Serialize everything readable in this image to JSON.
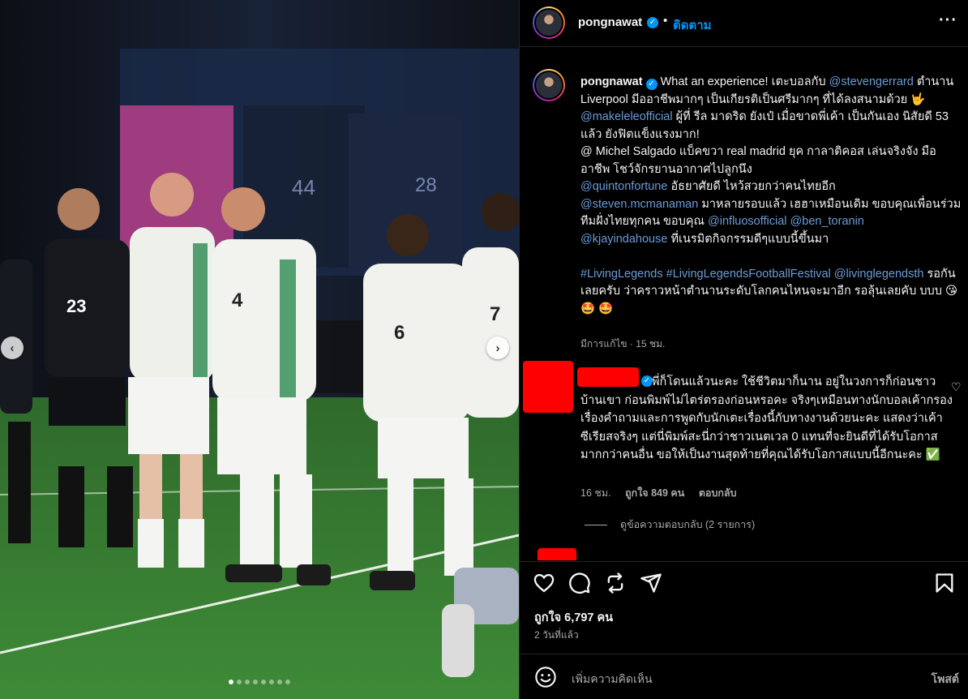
{
  "post": {
    "photo": {
      "jersey_numbers": [
        "23",
        "4",
        "6",
        "7",
        "44",
        "28"
      ],
      "carousel_prev": "‹",
      "carousel_next": "›",
      "dot_count": 8,
      "active_dot": 0
    },
    "header": {
      "username": "pongnawat",
      "bullet": "•",
      "follow_label": "ติดตาม",
      "more_label": "···"
    },
    "caption": {
      "username": "pongnawat",
      "text_a": "What an experience! เตะบอลกับ",
      "mention_gerrard": "@stevengerrard",
      "text_b": "ตำนาน Liverpool มีออาชีพมากๆ เป็นเกียรติเป็นศรีมากๆ ที่ได้ลงสนามด้วย 🤟",
      "mention_makelele": "@makeleleofficial",
      "text_c": "ผู้ที่ รีล มาดริด ยังเป๋ เมื่อขาดพี่เค้า เป็นกันเอง นิสัยดี 53 แล้ว ยังฟิตแข็งแรงมาก!",
      "text_d": "@ Michel Salgado แบ็คขวา real madrid ยุค กาลาติคอส เล่นจริงจัง มืออาชีพ โชว์จักรยานอากาศไปลูกนึง",
      "mention_fortune": "@quintonfortune",
      "text_e": "อัธยาศัยดี ไหว้สวยกว่าคนไทยอีก",
      "mention_mcmanaman": "@steven.mcmanaman",
      "text_f": "มาหลายรอบแล้ว เฮฮาเหมือนเดิม ขอบคุณเพื่อนร่วมทีมฝั่งไทยทุกคน ขอบคุณ",
      "mention_influos": "@influosofficial",
      "mention_toranin": "@ben_toranin",
      "mention_kjayinda": "@kjayindahouse",
      "text_g": "ที่เนรมิตกิจกรรมดีๆแบบนี้ขึ้นมา",
      "hashtag_1": "#LivingLegends",
      "hashtag_2": "#LivingLegendsFootballFestival",
      "mention_livinglegends": "@livinglegendsth",
      "text_h": "รอกันเลยครับ ว่าคราวหน้าตำนานระดับโลกคนไหนจะมาอีก รอลุ้นเลยคับ บบบ 😘 🤩 🤩",
      "meta": "มีการแก้ไข · 15 ชม."
    },
    "comment": {
      "text": "พี่ก็โดนแล้วนะคะ ใช้ชีวิตมาก็นาน อยู่ในวงการก็ก่อนชาวบ้านเขา ก่อนพิมพ์ไม่ไตร่ตรองก่อนหรอคะ จริงๆเหมือนทางนักบอลเค้ากรองเรื่องคำถามและการพูดกับนักเตะเรื่องนี้กับทางงานด้วยนะคะ แสดงว่าเค้าซีเรียสจริงๆ แต่นี่พิมพ์สะนี่กว่าชาวเนตเวล 0 แทนที่จะยินดีที่ได้รับโอกาสมากกว่าคนอื่น ขอให้เป็นงานสุดท้ายที่คุณได้รับโอกาสแบบนี้อีกนะคะ ✅",
      "time": "16 ชม.",
      "likes": "ถูกใจ 849 คน",
      "reply": "ตอบกลับ",
      "view_replies": "ดูข้อความตอบกลับ (2 รายการ)"
    },
    "actions": {
      "likes_count": "ถูกใจ 6,797 คน",
      "time_ago": "2 วันที่แล้ว"
    },
    "compose": {
      "placeholder": "เพิ่มความคิดเห็น",
      "post_label": "โพสต์"
    }
  },
  "colors": {
    "background": "#000000",
    "link": "#0095f6",
    "mention": "#6a9bd8",
    "muted": "#a8a8a8",
    "redaction": "#ff0000"
  }
}
